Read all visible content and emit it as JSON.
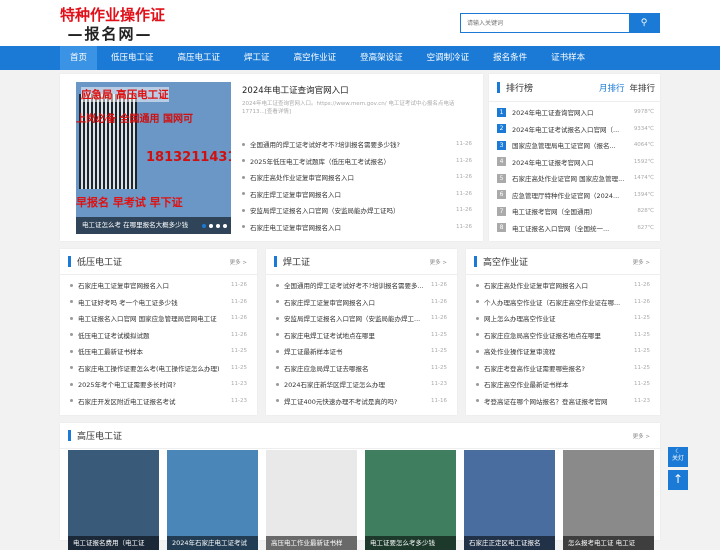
{
  "logo": {
    "line1": "特种作业操作证",
    "line2": "—报名网—"
  },
  "search": {
    "placeholder": "请输入关键词",
    "icon": "search-icon"
  },
  "nav": [
    "首页",
    "低压电工证",
    "高压电工证",
    "焊工证",
    "高空作业证",
    "登高架设证",
    "空调制冷证",
    "报名条件",
    "证书样本"
  ],
  "slider": {
    "image_texts": [
      "应急局 高压电工证",
      "上岗必备 全国通用 国网可",
      "18132114317",
      "早报名 早考试 早下证"
    ],
    "caption": "电工证怎么考 在哪里报名大概多少钱",
    "headline": "2024年电工证查询官网入口",
    "desc": "2024年电工证查询官网入口。https://www.mem.gov.cn/ 电工证考试中心报名点电话17713...[查看详情]",
    "items": [
      {
        "t": "全国通用的焊工证考试好考不?培训报名需要多少钱?",
        "d": "11-26"
      },
      {
        "t": "2025年低压电工考试题库（低压电工考试报名）",
        "d": "11-26"
      },
      {
        "t": "石家庄高处作业证复审官网报名入口",
        "d": "11-26"
      },
      {
        "t": "石家庄焊工证复审官网报名入口",
        "d": "11-26"
      },
      {
        "t": "安监局焊工证报名入口官网（安监局能办焊工证吗）",
        "d": "11-26"
      },
      {
        "t": "石家庄电工证复审官网报名入口",
        "d": "11-26"
      }
    ]
  },
  "rank": {
    "title": "排行榜",
    "tab_month": "月排行",
    "tab_year": "年排行",
    "items": [
      {
        "n": "1",
        "t": "2024年电工证查询官网入口",
        "v": "9978℃"
      },
      {
        "n": "2",
        "t": "2024年电工证考试报名入口官网（...",
        "v": "9334℃"
      },
      {
        "n": "3",
        "t": "国家应急管理局电工证官网（报名...",
        "v": "4064℃"
      },
      {
        "n": "4",
        "t": "2024年电工证报考官网入口",
        "v": "1592℃"
      },
      {
        "n": "5",
        "t": "石家庄高处作业证官网 国家应急管理...",
        "v": "1474℃"
      },
      {
        "n": "6",
        "t": "应急管理厅特种作业证官网（2024...",
        "v": "1394℃"
      },
      {
        "n": "7",
        "t": "电工证报考官网（全国通用）",
        "v": "828℃"
      },
      {
        "n": "8",
        "t": "电工证报名入口官网（全国统一...",
        "v": "627℃"
      }
    ]
  },
  "more": "更多 >",
  "col1": {
    "title": "低压电工证",
    "items": [
      {
        "t": "石家庄电工证复审官网报名入口",
        "d": "11-26"
      },
      {
        "t": "电工证好考吗 考一个电工证多少钱",
        "d": "11-26"
      },
      {
        "t": "电工证报名入口官网 国家应急管理局官网电工证",
        "d": "11-26"
      },
      {
        "t": "低压电工证考试模拟试题",
        "d": "11-26"
      },
      {
        "t": "低压电工最新证书样本",
        "d": "11-25"
      },
      {
        "t": "石家庄电工操作证要怎么考(电工操作证怎么办理)",
        "d": "11-25"
      },
      {
        "t": "2025年考个电工证需要多长时间?",
        "d": "11-23"
      },
      {
        "t": "石家庄开发区附近电工证报名考试",
        "d": "11-23"
      }
    ]
  },
  "col2": {
    "title": "焊工证",
    "items": [
      {
        "t": "全国通用的焊工证考试好考不?培训报名需要多...",
        "d": "11-26"
      },
      {
        "t": "石家庄焊工证复审官网报名入口",
        "d": "11-26"
      },
      {
        "t": "安监局焊工证报名入口官网（安监局能办焊工...",
        "d": "11-26"
      },
      {
        "t": "石家庄电焊工证考试地点在哪里",
        "d": "11-25"
      },
      {
        "t": "焊工证最新样本证书",
        "d": "11-25"
      },
      {
        "t": "石家庄应急局焊工证去哪报名",
        "d": "11-25"
      },
      {
        "t": "2024石家庄新华区焊工证怎么办理",
        "d": "11-23"
      },
      {
        "t": "焊工证400元快速办理不考试是真的吗?",
        "d": "11-16"
      }
    ]
  },
  "col3": {
    "title": "高空作业证",
    "items": [
      {
        "t": "石家庄高处作业证复审官网报名入口",
        "d": "11-26"
      },
      {
        "t": "个人办理高空作业证（石家庄高空作业证在哪...",
        "d": "11-26"
      },
      {
        "t": "网上怎么办理高空作业证",
        "d": "11-25"
      },
      {
        "t": "石家庄应急局高空作业证报名地点在哪里",
        "d": "11-25"
      },
      {
        "t": "高处作业操作证复审流程",
        "d": "11-25"
      },
      {
        "t": "石家庄考登高作业证需要哪些报名?",
        "d": "11-25"
      },
      {
        "t": "石家庄高空作业最新证书样本",
        "d": "11-25"
      },
      {
        "t": "考登高证在哪个网站报名？登高证报考官网",
        "d": "11-23"
      }
    ]
  },
  "big": {
    "title": "高压电工证",
    "thumbs": [
      {
        "cap": "电工证报名费用（电工证",
        "bg": "#3a5a7a"
      },
      {
        "cap": "2024年石家庄电工证考试",
        "bg": "#4a86b8"
      },
      {
        "cap": "高压电工作业最新证书样",
        "bg": "#e9e9e9"
      },
      {
        "cap": "电工证要怎么考多少钱",
        "bg": "#3f7f5f"
      },
      {
        "cap": "石家庄正定区电工证报名",
        "bg": "#4a6da0"
      },
      {
        "cap": "怎么报考电工证 电工证",
        "bg": "#8a8a8a"
      }
    ]
  },
  "float": {
    "night": "关灯",
    "top_icon": "arrow-up-icon"
  }
}
